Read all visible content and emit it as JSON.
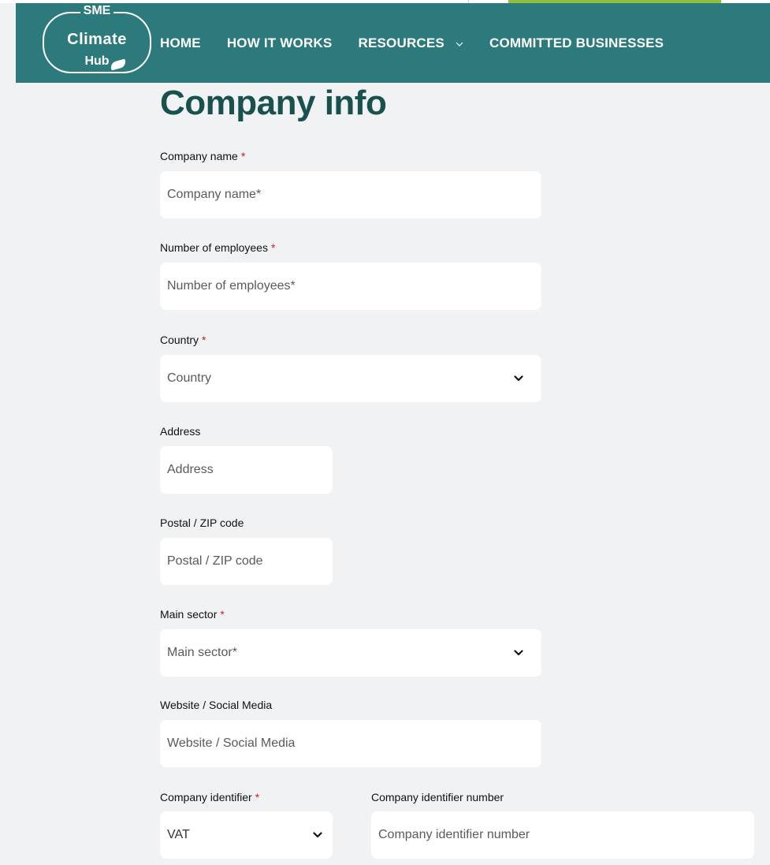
{
  "brand": {
    "logo_top": "SME",
    "logo_middle": "Climate",
    "logo_bottom": "Hub"
  },
  "nav": {
    "items": [
      {
        "label": "HOME"
      },
      {
        "label": "HOW IT WORKS"
      },
      {
        "label": "RESOURCES"
      },
      {
        "label": "COMMITTED BUSINESSES"
      }
    ]
  },
  "page": {
    "title": "Company info"
  },
  "form": {
    "required_marker": "*",
    "company_name": {
      "label": "Company name",
      "placeholder": "Company name*"
    },
    "employees": {
      "label": "Number of employees",
      "placeholder": "Number of employees*"
    },
    "country": {
      "label": "Country",
      "value": "Country"
    },
    "address": {
      "label": "Address",
      "placeholder": "Address"
    },
    "postal": {
      "label": "Postal / ZIP code",
      "placeholder": "Postal / ZIP code"
    },
    "sector": {
      "label": "Main sector",
      "value": "Main sector*"
    },
    "website": {
      "label": "Website / Social Media",
      "placeholder": "Website / Social Media"
    },
    "identifier": {
      "label": "Company identifier",
      "value": "VAT"
    },
    "identifier_number": {
      "label": "Company identifier number",
      "placeholder": "Company identifier number"
    }
  },
  "colors": {
    "header": "#2c7a7b",
    "accent": "#8dbf3f",
    "title": "#19514f",
    "required": "#d11a2a",
    "background": "#f1f2f4"
  },
  "icons": {
    "dropdown": "chevron-down-icon",
    "logo_leaf": "leaf-icon"
  }
}
